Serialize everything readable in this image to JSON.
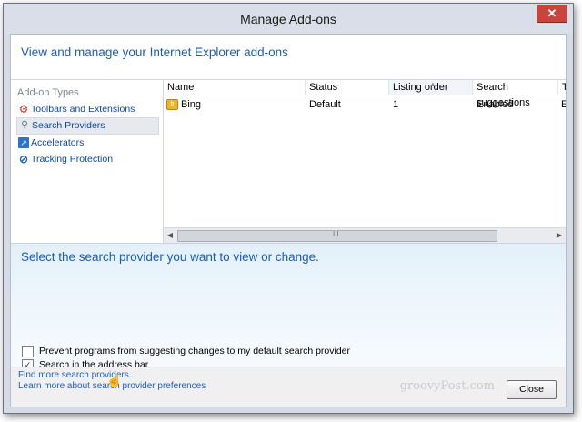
{
  "window": {
    "title": "Manage Add-ons",
    "close_glyph": "✕"
  },
  "header": {
    "text": "View and manage your Internet Explorer add-ons"
  },
  "sidebar": {
    "section_label": "Add-on Types",
    "items": [
      {
        "label": "Toolbars and Extensions",
        "icon": "gear-icon"
      },
      {
        "label": "Search Providers",
        "icon": "magnifier-icon"
      },
      {
        "label": "Accelerators",
        "icon": "accelerator-icon"
      },
      {
        "label": "Tracking Protection",
        "icon": "tracking-protection-icon"
      }
    ]
  },
  "list": {
    "columns": [
      "Name",
      "Status",
      "Listing order",
      "Search suggestions",
      "T"
    ],
    "rows": [
      {
        "name": "Bing",
        "status": "Default",
        "listing_order": "1",
        "search_suggestions": "Enabled",
        "extra": "E"
      }
    ],
    "scroll_grip": "III"
  },
  "detail": {
    "prompt": "Select the search provider you want to view or change.",
    "checkboxes": [
      {
        "label": "Prevent programs from suggesting changes to my default search provider",
        "checked": false
      },
      {
        "label": "Search in the address bar",
        "checked": true
      }
    ]
  },
  "footer": {
    "link1": "Find more search providers...",
    "link2": "Learn more about search provider preferences",
    "close_label": "Close",
    "watermark": "groovyPost.com"
  },
  "colors": {
    "link_blue": "#2161bd",
    "heading_blue": "#1d5db3",
    "close_red": "#c7453d"
  }
}
